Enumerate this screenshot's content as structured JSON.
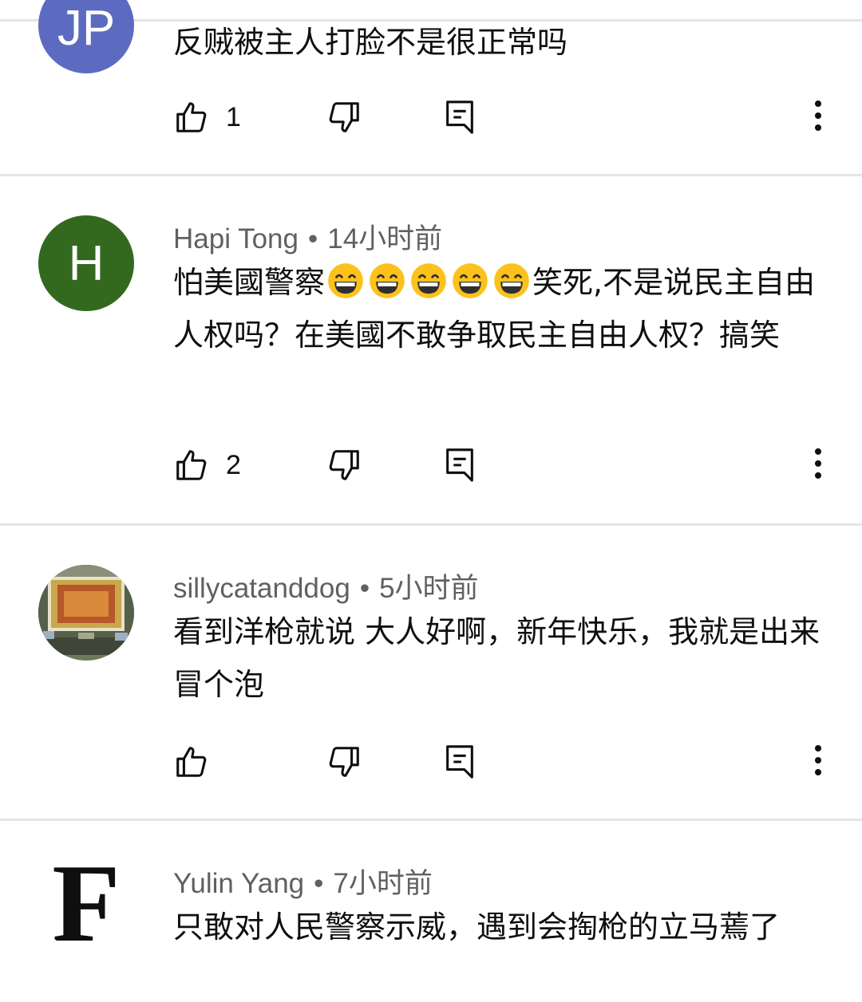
{
  "comments": [
    {
      "avatar_text": "JP",
      "avatar_color": "#5c6bc0",
      "text": "反贼被主人打脸不是很正常吗",
      "likes": "1"
    },
    {
      "author": "Hapi Tong",
      "time": "14小时前",
      "avatar_text": "H",
      "avatar_color": "#33691e",
      "text_before": "怕美國警察",
      "emoji_count": 5,
      "text_after": "笑死,不是说民主自由人权吗？在美國不敢争取民主自由人权？搞笑",
      "likes": "2"
    },
    {
      "author": "sillycatanddog",
      "time": "5小时前",
      "avatar_icon": "board-game-photo",
      "text": "看到洋枪就说 大人好啊，新年快乐，我就是出来冒个泡",
      "likes": ""
    },
    {
      "author": "Yulin Yang",
      "time": "7小时前",
      "avatar_text": "F",
      "text": "只敢对人民警察示威，遇到会掏枪的立马蔫了"
    }
  ],
  "icons": {
    "like": "thumb-up-icon",
    "dislike": "thumb-down-icon",
    "reply": "reply-comment-icon",
    "more": "more-vert-icon"
  },
  "separator": "•"
}
